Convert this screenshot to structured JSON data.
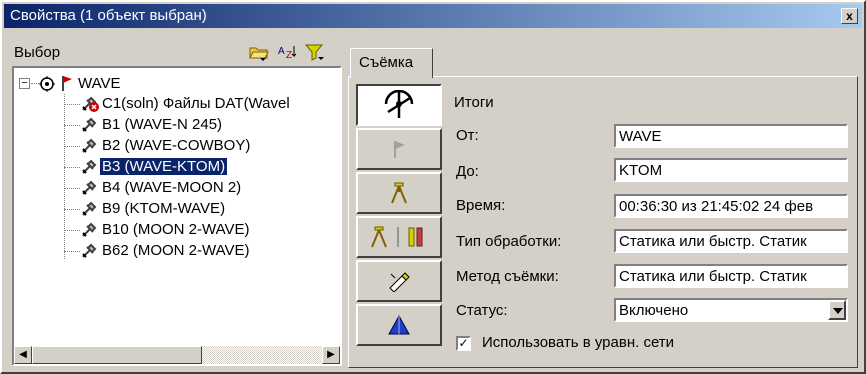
{
  "window": {
    "title": "Свойства (1 объект выбран)",
    "close_label": "x"
  },
  "left": {
    "header_label": "Выбор",
    "root": {
      "label": "WAVE"
    },
    "items": [
      {
        "label": "C1(soln) Файлы DAT(Wavel",
        "icon": "remove-data-icon"
      },
      {
        "label": "B1 (WAVE-N 245)",
        "icon": "satellite-icon"
      },
      {
        "label": "B2 (WAVE-COWBOY)",
        "icon": "satellite-icon"
      },
      {
        "label": "B3 (WAVE-KTOM)",
        "icon": "satellite-icon",
        "selected": true
      },
      {
        "label": "B4 (WAVE-MOON 2)",
        "icon": "satellite-icon"
      },
      {
        "label": "B9 (KTOM-WAVE)",
        "icon": "satellite-icon"
      },
      {
        "label": "B10 (MOON 2-WAVE)",
        "icon": "satellite-icon"
      },
      {
        "label": "B62 (MOON 2-WAVE)",
        "icon": "satellite-icon"
      }
    ]
  },
  "right": {
    "tab_label": "Съёмка",
    "section_title": "Итоги",
    "rows": {
      "from": {
        "label": "От:",
        "value": "WAVE"
      },
      "to": {
        "label": "До:",
        "value": "KTOM"
      },
      "time": {
        "label": "Время:",
        "value": "00:36:30 из 21:45:02 24 фев"
      },
      "processing": {
        "label": "Тип обработки:",
        "value": "Статика или быстр. Статик"
      },
      "method": {
        "label": "Метод съёмки:",
        "value": "Статика или быстр. Статик"
      },
      "status": {
        "label": "Статус:",
        "value": "Включено"
      }
    },
    "checkbox_label": "Использовать в уравн. сети",
    "checkbox_checked": true
  },
  "colors": {
    "titlebar": "#0a246a",
    "selection": "#0a246a",
    "face": "#d4d0c8"
  }
}
